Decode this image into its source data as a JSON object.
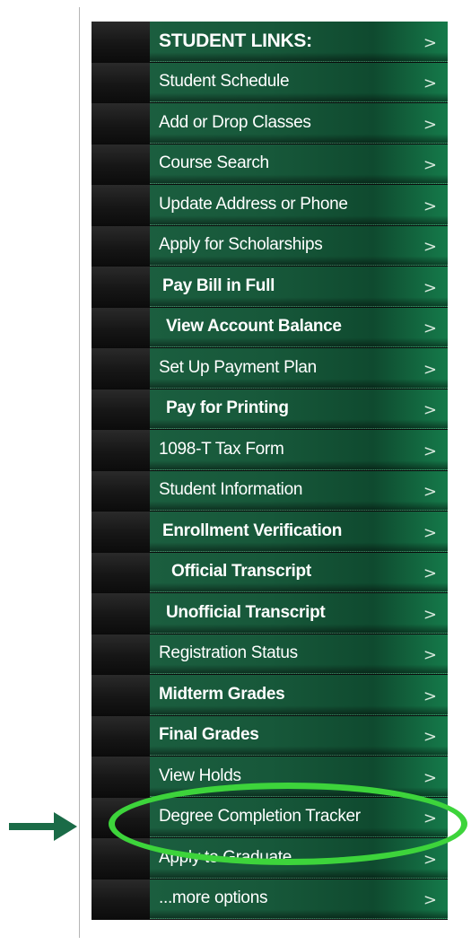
{
  "menu": {
    "header": "STUDENT LINKS:",
    "chevron": ">",
    "items": [
      {
        "label": "Student Schedule"
      },
      {
        "label": "Add or Drop Classes"
      },
      {
        "label": "Course Search"
      },
      {
        "label": "Update Address or Phone"
      },
      {
        "label": "Apply for Scholarships"
      },
      {
        "label": "Pay Bill in Full"
      },
      {
        "label": "View Account Balance"
      },
      {
        "label": "Set Up Payment Plan"
      },
      {
        "label": "Pay for Printing"
      },
      {
        "label": "1098-T Tax Form"
      },
      {
        "label": "Student Information"
      },
      {
        "label": "Enrollment Verification"
      },
      {
        "label": "Official Transcript"
      },
      {
        "label": "Unofficial Transcript"
      },
      {
        "label": "Registration Status"
      },
      {
        "label": "Midterm Grades"
      },
      {
        "label": "Final Grades"
      },
      {
        "label": "View Holds"
      },
      {
        "label": "Degree Completion Tracker"
      },
      {
        "label": "Apply to Graduate"
      },
      {
        "label": "...more options"
      }
    ]
  },
  "annotation": {
    "highlight_color": "#3dd43b",
    "arrow_color": "#1a6b47"
  }
}
